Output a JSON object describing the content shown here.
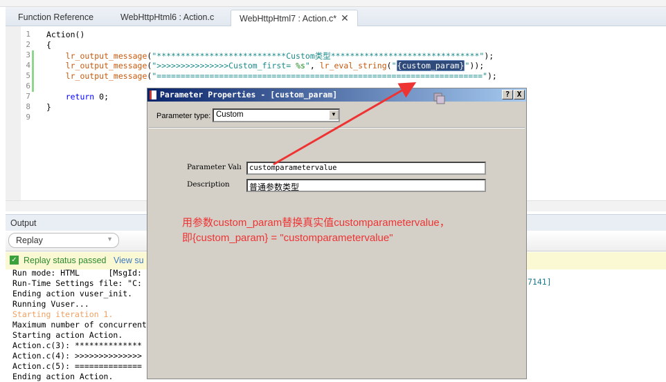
{
  "tabs": [
    {
      "label": "Function Reference"
    },
    {
      "label": "WebHttpHtml6 : Action.c"
    },
    {
      "label": "WebHttpHtml7 : Action.c*",
      "active": true
    }
  ],
  "editor": {
    "line_numbers": [
      "1",
      "2",
      "3",
      "4",
      "5",
      "6",
      "7",
      "8",
      "9"
    ],
    "lines": [
      [
        {
          "t": "Action()",
          "c": "blk"
        }
      ],
      [
        {
          "t": "{",
          "c": "blk"
        }
      ],
      [
        {
          "t": "    lr_output_message",
          "c": "fn"
        },
        {
          "t": "(",
          "c": "blk"
        },
        {
          "t": "\"***************************Custom类型*******************************\"",
          "c": "st"
        },
        {
          "t": ");",
          "c": "blk"
        }
      ],
      [
        {
          "t": "    lr_output_message",
          "c": "fn"
        },
        {
          "t": "(",
          "c": "blk"
        },
        {
          "t": "\">>>>>>>>>>>>>>>Custom_first= ",
          "c": "st"
        },
        {
          "t": "%s",
          "c": "fmt"
        },
        {
          "t": "\"",
          "c": "st"
        },
        {
          "t": ", ",
          "c": "blk"
        },
        {
          "t": "lr_eval_string",
          "c": "fn"
        },
        {
          "t": "(",
          "c": "blk"
        },
        {
          "t": "\"",
          "c": "st"
        },
        {
          "t": "{custom_param}",
          "c": "hl"
        },
        {
          "t": "\"",
          "c": "st"
        },
        {
          "t": "));",
          "c": "blk"
        }
      ],
      [
        {
          "t": "    lr_output_message",
          "c": "fn"
        },
        {
          "t": "(",
          "c": "blk"
        },
        {
          "t": "\"====================================================================\"",
          "c": "st"
        },
        {
          "t": ");",
          "c": "blk"
        }
      ],
      [],
      [
        {
          "t": "    return ",
          "c": "kw"
        },
        {
          "t": "0;",
          "c": "blk"
        }
      ],
      [
        {
          "t": "}",
          "c": "blk"
        }
      ],
      []
    ]
  },
  "output": {
    "title": "Output",
    "dropdown_value": "Replay",
    "status_text": "Replay status passed",
    "view_link": "View su",
    "log": [
      {
        "t": "Run mode: HTML      [MsgId:"
      },
      {
        "t": "Run-Time Settings file: \"C:"
      },
      {
        "t": "Ending action vuser_init."
      },
      {
        "t": "Running Vuser..."
      },
      {
        "t": "Starting iteration 1.",
        "c": "orange"
      },
      {
        "t": "Maximum number of concurrent"
      },
      {
        "t": "Starting action Action."
      },
      {
        "t": "Action.c(3): **************"
      },
      {
        "t": "Action.c(4): >>>>>>>>>>>>>>"
      },
      {
        "t": "Action.c(5): =============="
      },
      {
        "t": "Ending action Action."
      }
    ],
    "log_tail": "7141]"
  },
  "dialog": {
    "title": "Parameter Properties - [custom_param]",
    "help": "?",
    "close": "X",
    "param_type_label": "Parameter type:",
    "param_type_value": "Custom",
    "value_label": "Parameter Valı",
    "value": "customparametervalue",
    "desc_label": "Description",
    "desc": "普通参数类型"
  },
  "annotation": {
    "line1": "用参数custom_param替换真实值customparametervalue，",
    "line2": "即{custom_param} = \"customparametervalue\"",
    "color": "#ee3333"
  }
}
